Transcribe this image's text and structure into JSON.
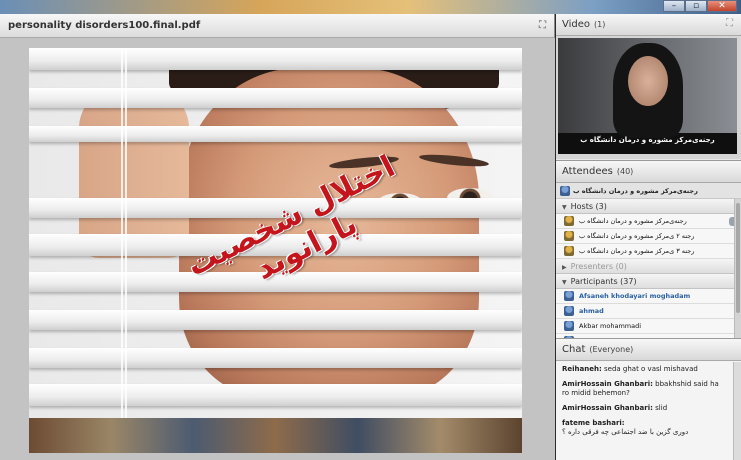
{
  "window": {
    "minimize": "–",
    "restore": "▫",
    "close": "✕"
  },
  "document": {
    "title": "personality disorders100.final.pdf",
    "slide_text": "اختلال شخصیت پارانوید"
  },
  "video": {
    "title": "Video",
    "count": "(1)",
    "caption": "رجنه‌ی‌مرکز مشوره و درمان دانشگاه ب"
  },
  "attendees": {
    "title": "Attendees",
    "count": "(40)",
    "self_line": "رجنه‌ی‌مرکز مشوره و درمان دانشگاه ب",
    "hosts": {
      "label": "Hosts (3)",
      "items": [
        "رجنه‌ی‌مرکز مشوره و درمان دانشگاه ب",
        "رجنه ۲ ی‌مرکز مشوره و درمان دانشگاه ب",
        "رجنه ۳ ی‌مرکز مشوره و درمان دانشگاه ب"
      ]
    },
    "presenters": {
      "label": "Presenters (0)"
    },
    "participants": {
      "label": "Participants (37)",
      "items": [
        "Afsaneh khodayari moghadam",
        "ahmad",
        "Akbar mohammadi",
        "AmirHossain Ghanbari"
      ]
    }
  },
  "chat": {
    "title": "Chat",
    "scope": "(Everyone)",
    "messages": [
      {
        "sender": "Reihaneh:",
        "text": " seda ghat o vasl mishavad"
      },
      {
        "sender": "AmirHossain Ghanbari:",
        "text": " bbakhshid said  ha ro midid behemon?"
      },
      {
        "sender": "AmirHossain Ghanbari:",
        "text": " slid"
      },
      {
        "sender": "fateme bashari:",
        "text": "دوری گزین با ضد اجتماعی چه فرقی داره ؟"
      }
    ]
  }
}
